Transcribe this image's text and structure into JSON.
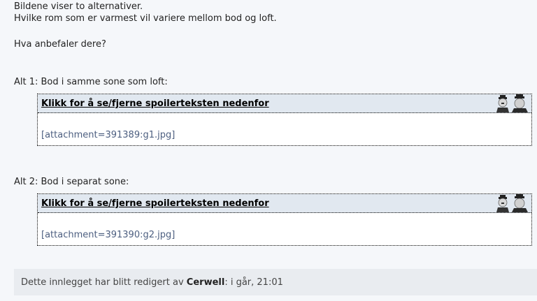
{
  "post": {
    "lines": [
      "Bildene viser to alternativer.",
      "Hvilke rom som er varmest vil variere mellom bod og loft.",
      "Hva anbefaler dere?"
    ],
    "alt1_label": "Alt 1: Bod i samme sone som loft:",
    "alt2_label": "Alt 2: Bod i separat sone:"
  },
  "spoilers": [
    {
      "toggle_label": "Klikk for å se/fjerne spoilerteksten nedenfor",
      "attachment": "[attachment=391389:g1.jpg]",
      "icon": "spoiler-figures-icon"
    },
    {
      "toggle_label": "Klikk for å se/fjerne spoilerteksten nedenfor",
      "attachment": "[attachment=391390:g2.jpg]",
      "icon": "spoiler-figures-icon"
    }
  ],
  "edit_note": {
    "prefix": "Dette innlegget har blitt redigert av",
    "user": "Cerwell",
    "suffix": ": i går, 21:01"
  },
  "colors": {
    "page_background": "#f5f7fa",
    "spoiler_header": "#e1e8f0",
    "link": "#4d5f80",
    "edit_note_background": "#e9ecf0"
  }
}
